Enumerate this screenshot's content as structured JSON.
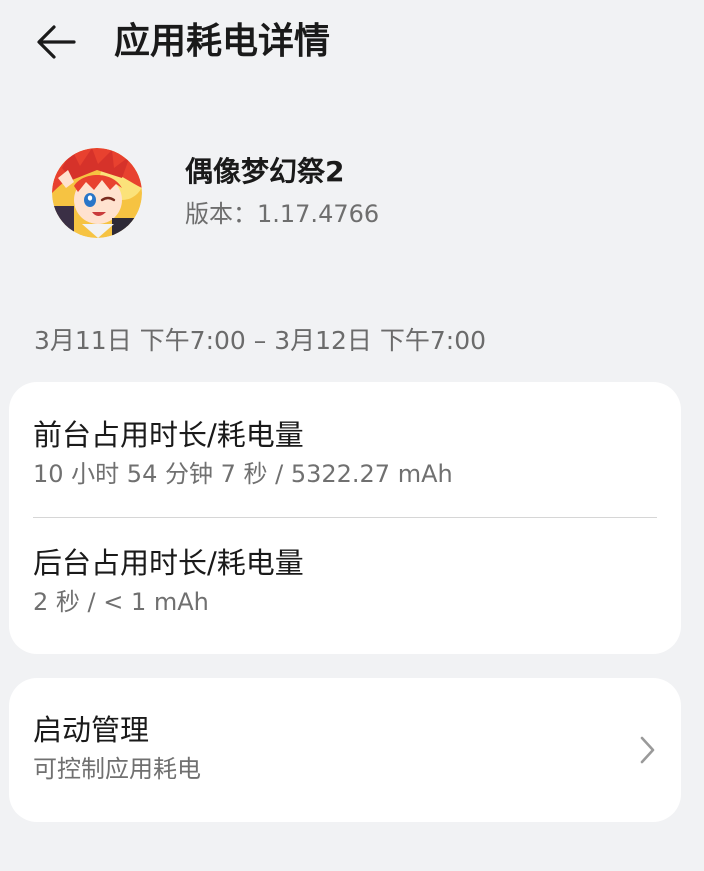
{
  "header": {
    "title": "应用耗电详情",
    "back_icon": "arrow-left-icon"
  },
  "app": {
    "name": "偶像梦幻祭2",
    "version": "版本：1.17.4766",
    "avatar_icon": "app-avatar"
  },
  "date_range": "3月11日 下午7:00 – 3月12日 下午7:00",
  "usage": {
    "foreground": {
      "title": "前台占用时长/耗电量",
      "value": "10 小时 54 分钟 7 秒 / 5322.27 mAh"
    },
    "background": {
      "title": "后台占用时长/耗电量",
      "value": "2 秒 / < 1 mAh"
    }
  },
  "launch": {
    "title": "启动管理",
    "subtitle": "可控制应用耗电",
    "chevron_icon": "chevron-right-icon"
  },
  "colors": {
    "background": "#f1f2f4",
    "card": "#ffffff",
    "primary_text": "#1a1a1a",
    "secondary_text": "#707070",
    "divider": "#d6d6d6"
  }
}
